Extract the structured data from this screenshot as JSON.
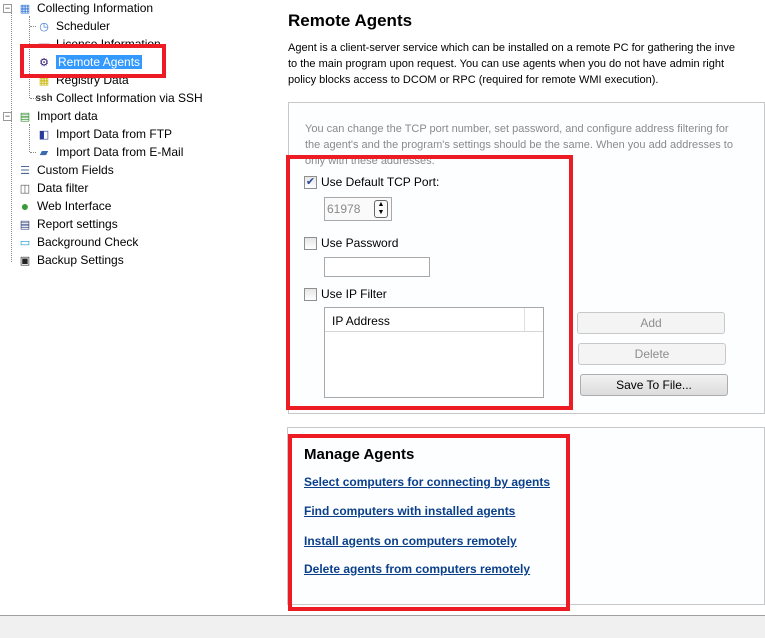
{
  "tree": {
    "items": [
      {
        "label": "Collecting Information",
        "icon": "network-icon",
        "level": 0
      },
      {
        "label": "Scheduler",
        "icon": "clock-icon",
        "level": 1
      },
      {
        "label": "License Information",
        "icon": "license-icon",
        "level": 1
      },
      {
        "label": "Remote Agents",
        "icon": "gears-icon",
        "level": 1,
        "selected": true
      },
      {
        "label": "Registry Data",
        "icon": "registry-grid-icon",
        "level": 1
      },
      {
        "label": "Collect Information via SSH",
        "icon": "ssh-icon",
        "level": 1
      },
      {
        "label": "Import data",
        "icon": "import-icon",
        "level": 0
      },
      {
        "label": "Import Data from FTP",
        "icon": "ftp-import-icon",
        "level": 1
      },
      {
        "label": "Import Data from E-Mail",
        "icon": "email-import-icon",
        "level": 1
      },
      {
        "label": "Custom Fields",
        "icon": "list-icon",
        "level": 0
      },
      {
        "label": "Data filter",
        "icon": "binoculars-icon",
        "level": 0
      },
      {
        "label": "Web Interface",
        "icon": "globe-icon",
        "level": 0
      },
      {
        "label": "Report settings",
        "icon": "document-icon",
        "level": 0
      },
      {
        "label": "Background Check",
        "icon": "monitor-icon",
        "level": 0
      },
      {
        "label": "Backup Settings",
        "icon": "floppy-icon",
        "level": 0
      }
    ],
    "ssh_glyph": "ssh"
  },
  "main": {
    "title": "Remote Agents",
    "description": [
      "Agent is a client-server service which can be installed on a remote PC for gathering the inve",
      "to the main program upon request. You can use agents when you do not have admin right",
      "policy blocks access to DCOM or RPC (required for remote WMI execution)."
    ],
    "settings_hint": [
      "You can change the TCP port number, set password, and configure address filtering for",
      "the agent's and the program's settings should be the same. When you add addresses to",
      "only with these addresses."
    ],
    "use_default_port": {
      "label": "Use Default TCP Port:",
      "checked": true
    },
    "port_value": "61978",
    "use_password": {
      "label": "Use Password",
      "checked": false
    },
    "password_value": "",
    "use_ip_filter": {
      "label": "Use IP Filter",
      "checked": false
    },
    "ip_list_header": "IP Address",
    "buttons": {
      "add": "Add",
      "delete": "Delete",
      "save": "Save To File..."
    }
  },
  "manage": {
    "title": "Manage Agents",
    "links": [
      "Select computers for connecting by agents",
      "Find computers with installed agents",
      "Install agents on computers remotely",
      "Delete agents from computers remotely"
    ]
  },
  "colors": {
    "highlight": "#ed1c24",
    "selection": "#3399ff",
    "link": "#0a3f8a"
  }
}
